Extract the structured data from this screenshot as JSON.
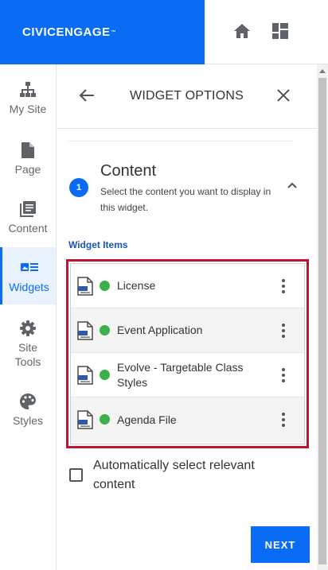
{
  "brand": {
    "name": "CIVICENGAGE",
    "mark": "™"
  },
  "sidebar": {
    "items": [
      {
        "label": "My Site",
        "icon": "sitemap-icon"
      },
      {
        "label": "Page",
        "icon": "page-icon"
      },
      {
        "label": "Content",
        "icon": "content-icon"
      },
      {
        "label": "Widgets",
        "icon": "widgets-icon",
        "active": true
      },
      {
        "label": "Site",
        "label2": "Tools",
        "icon": "gear-icon"
      },
      {
        "label": "Styles",
        "icon": "palette-icon"
      }
    ]
  },
  "panel": {
    "title": "WIDGET OPTIONS",
    "step": {
      "number": "1",
      "title": "Content",
      "description": "Select the content you want to display in this widget."
    },
    "widget_items_label": "Widget Items",
    "items": [
      {
        "label": "License",
        "status": "published"
      },
      {
        "label": "Event Application",
        "status": "published"
      },
      {
        "label": "Evolve - Targetable Class Styles",
        "status": "published"
      },
      {
        "label": "Agenda File",
        "status": "published"
      }
    ],
    "auto_select_label": "Automatically select relevant content",
    "auto_select_checked": false,
    "next_label": "NEXT"
  },
  "colors": {
    "brand_blue": "#0a6cf5",
    "highlight_red": "#c3122f",
    "status_green": "#3db049",
    "label_blue": "#1a55b8"
  }
}
